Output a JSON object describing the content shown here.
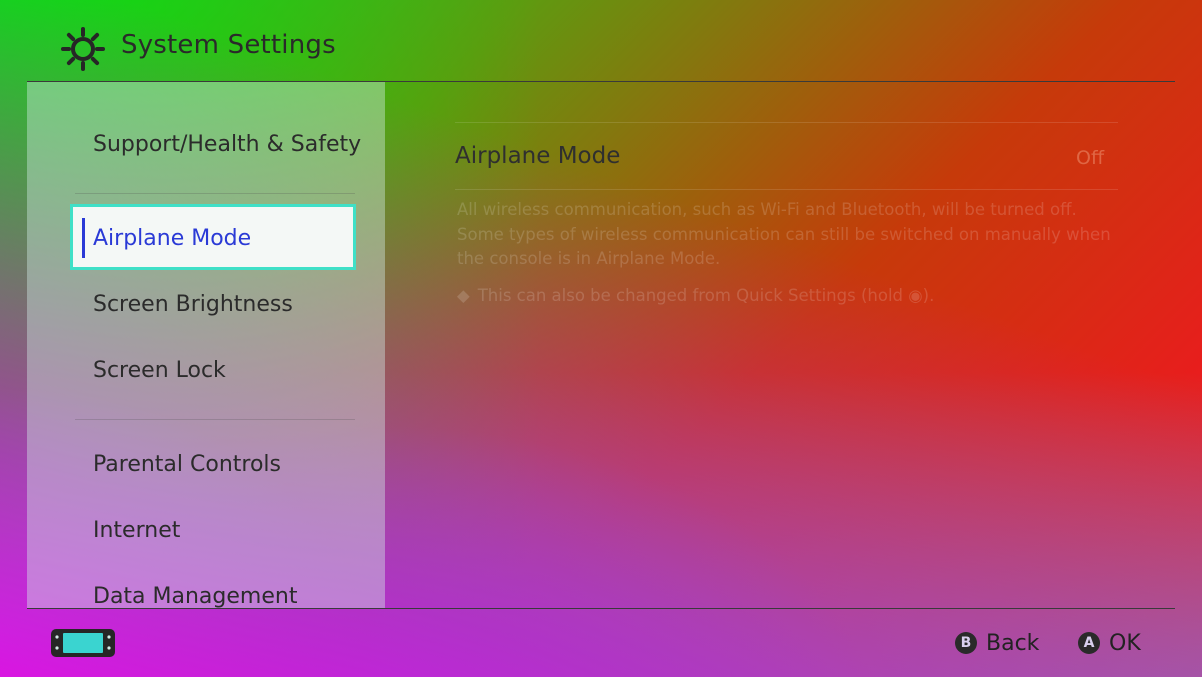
{
  "header": {
    "title": "System Settings",
    "icon": "gear-icon"
  },
  "sidebar": {
    "items": [
      {
        "label": "Support/Health & Safety"
      },
      {
        "label": "Airplane Mode",
        "selected": true
      },
      {
        "label": "Screen Brightness"
      },
      {
        "label": "Screen Lock"
      },
      {
        "label": "Parental Controls"
      },
      {
        "label": "Internet"
      },
      {
        "label": "Data Management"
      }
    ]
  },
  "main": {
    "setting_name": "Airplane Mode",
    "setting_value": "Off",
    "description_lines": [
      "All wireless communication, such as Wi-Fi and Bluetooth, will be turned off.",
      "Some types of wireless communication can still be switched on manually when",
      "the console is in Airplane Mode."
    ],
    "note": "This can also be changed from Quick Settings (hold ◉)."
  },
  "footer": {
    "console_icon": "handheld-console-icon",
    "back_glyph": "B",
    "back_label": "Back",
    "ok_glyph": "A",
    "ok_label": "OK"
  },
  "colors": {
    "selection_border": "#3fe0c7",
    "selection_text": "#2a3ad6"
  }
}
